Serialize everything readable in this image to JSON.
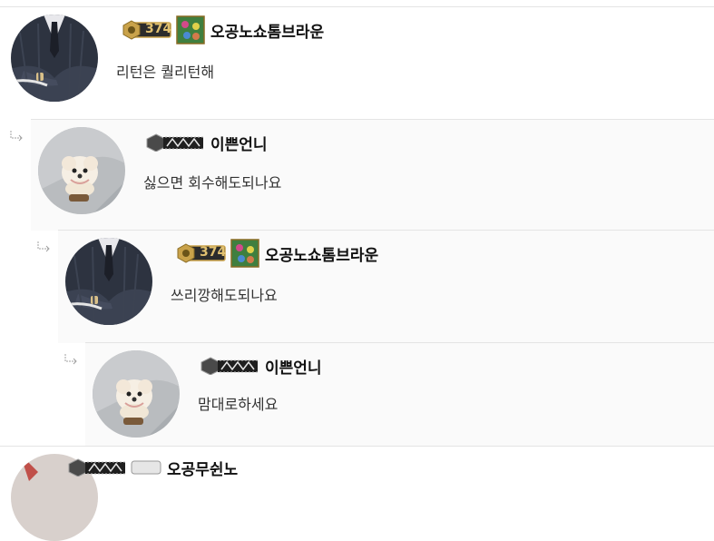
{
  "comments": [
    {
      "nickname": "오공노쇼톰브라운",
      "level": "374",
      "text": "리턴은 퀄리턴해",
      "avatar": "suit-avatar"
    },
    {
      "nickname": "이쁜언니",
      "text": "싫으면 회수해도되나요",
      "avatar": "puppy-avatar"
    },
    {
      "nickname": "오공노쇼톰브라운",
      "level": "374",
      "text": "쓰리깡해도되나요",
      "avatar": "suit-avatar"
    },
    {
      "nickname": "이쁜언니",
      "text": "맘대로하세요",
      "avatar": "puppy-avatar"
    },
    {
      "nickname": "오공무쉰노"
    }
  ],
  "colors": {
    "badge_gold": "#c9a24a",
    "badge_dark": "#3a3a3a",
    "border": "#e4e4e4",
    "reply_bg": "#fafafa"
  }
}
